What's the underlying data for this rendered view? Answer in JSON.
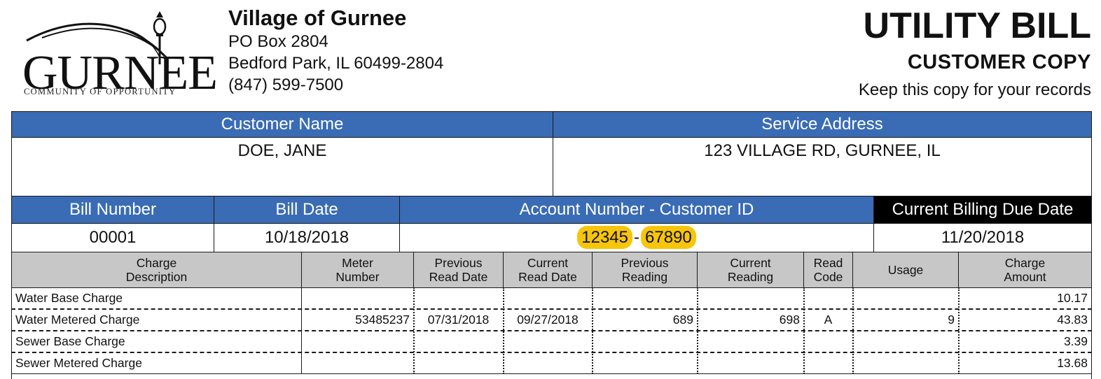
{
  "logo": {
    "wordmark": "GURNEE",
    "tagline": "COMMUNITY OF OPPORTUNITY",
    "icon": "lamp-post-swoosh-icon"
  },
  "org": {
    "name": "Village of Gurnee",
    "address1": "PO Box 2804",
    "address2": "Bedford Park, IL 60499-2804",
    "phone": "(847) 599-7500"
  },
  "title": {
    "main": "UTILITY BILL",
    "sub": "CUSTOMER COPY",
    "note": "Keep this copy for your records"
  },
  "customer": {
    "name_label": "Customer Name",
    "name": "DOE, JANE",
    "address_label": "Service Address",
    "address": "123 VILLAGE RD, GURNEE, IL"
  },
  "billing": {
    "bill_number_label": "Bill Number",
    "bill_number": "00001",
    "bill_date_label": "Bill Date",
    "bill_date": "10/18/2018",
    "account_label": "Account Number - Customer ID",
    "account_number": "12345",
    "separator": "-",
    "customer_id": "67890",
    "due_label": "Current Billing Due Date",
    "due_date": "11/20/2018"
  },
  "charges": {
    "headers": {
      "description": [
        "Charge",
        "Description"
      ],
      "meter": [
        "Meter",
        "Number"
      ],
      "prev_date": [
        "Previous",
        "Read Date"
      ],
      "curr_date": [
        "Current",
        "Read Date"
      ],
      "prev_reading": [
        "Previous",
        "Reading"
      ],
      "curr_reading": [
        "Current",
        "Reading"
      ],
      "read_code": [
        "Read",
        "Code"
      ],
      "usage": [
        "Usage"
      ],
      "amount": [
        "Charge",
        "Amount"
      ]
    },
    "rows": [
      {
        "description": "Water Base Charge",
        "meter": "",
        "prev_date": "",
        "curr_date": "",
        "prev_reading": "",
        "curr_reading": "",
        "read_code": "",
        "usage": "",
        "amount": "10.17"
      },
      {
        "description": "Water Metered Charge",
        "meter": "53485237",
        "prev_date": "07/31/2018",
        "curr_date": "09/27/2018",
        "prev_reading": "689",
        "curr_reading": "698",
        "read_code": "A",
        "usage": "9",
        "amount": "43.83"
      },
      {
        "description": "Sewer Base Charge",
        "meter": "",
        "prev_date": "",
        "curr_date": "",
        "prev_reading": "",
        "curr_reading": "",
        "read_code": "",
        "usage": "",
        "amount": "3.39"
      },
      {
        "description": "Sewer Metered Charge",
        "meter": "",
        "prev_date": "",
        "curr_date": "",
        "prev_reading": "",
        "curr_reading": "",
        "read_code": "",
        "usage": "",
        "amount": "13.68"
      }
    ]
  },
  "colors": {
    "header_blue": "#3a6cb5",
    "header_black": "#000000",
    "table_header_gray": "#c7c7c7",
    "highlight_yellow": "#f7c50a"
  }
}
